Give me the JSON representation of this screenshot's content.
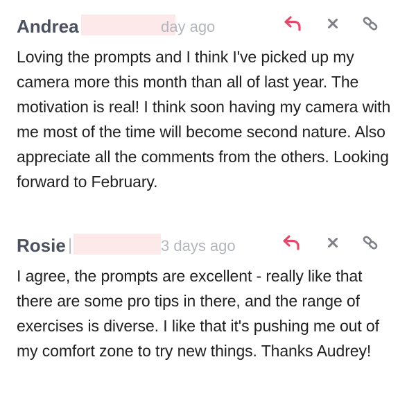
{
  "comments": [
    {
      "author": "Andrea",
      "time": "day ago",
      "separator": "",
      "text": "Loving the prompts and I think I've picked up my camera more this month than all of last year. The motivation is real! I think soon having my camera with me most of the time will become second nature. Also appreciate all the comments from the others. Looking forward to February."
    },
    {
      "author": "Rosie",
      "time": "3 days ago",
      "separator": "|",
      "text": "I agree, the prompts are excellent - really like that there are some pro tips in there, and the range of exercises is diverse. I like that it's pushing me out of my comfort zone to try new things. Thanks Audrey!"
    }
  ],
  "icons": {
    "reply": "reply-arrow-icon",
    "delete": "close-x-icon",
    "link": "chain-link-icon"
  },
  "colors": {
    "author": "#4a5060",
    "time": "#b3b7bd",
    "reply_icon": "#e8476a",
    "action_icon": "#7c7f86",
    "redaction": "#fde9ea",
    "body_text": "#1f1f1f"
  }
}
